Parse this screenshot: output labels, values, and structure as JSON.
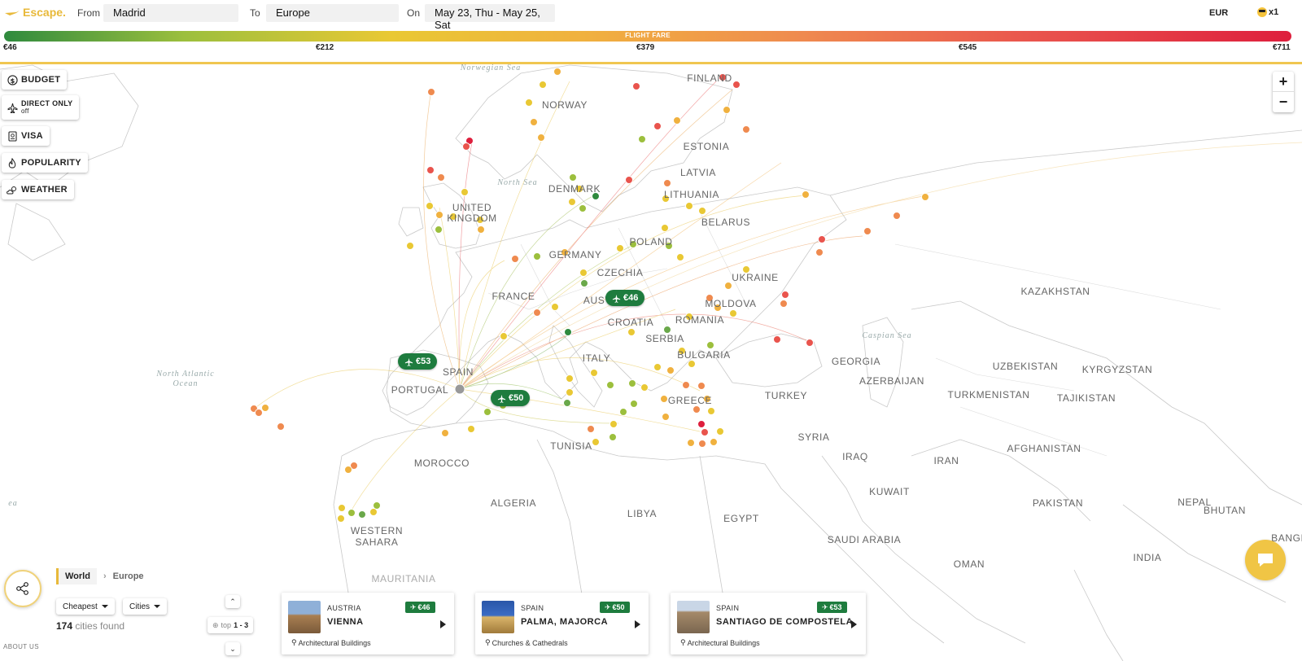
{
  "header": {
    "logo": "Escape.",
    "from_label": "From",
    "from_value": "Madrid",
    "to_label": "To",
    "to_value": "Europe",
    "on_label": "On",
    "on_value": "May 23, Thu - May 25, Sat",
    "currency": "EUR",
    "passengers": "x1"
  },
  "fare_bar": {
    "title": "FLIGHT FARE",
    "ticks": [
      "€46",
      "€212",
      "€379",
      "€545",
      "€711"
    ],
    "colors": [
      "#2f8a3e",
      "#e9c834",
      "#ef8a4f",
      "#de1f3d"
    ]
  },
  "filters": [
    {
      "label": "BUDGET",
      "icon": "dollar-icon"
    },
    {
      "label": "DIRECT ONLY",
      "sub": "off",
      "icon": "plane-icon"
    },
    {
      "label": "VISA",
      "icon": "passport-icon"
    },
    {
      "label": "POPULARITY",
      "icon": "flame-icon"
    },
    {
      "label": "WEATHER",
      "icon": "cloud-sun-icon"
    }
  ],
  "zoom": {
    "in": "+",
    "out": "−"
  },
  "map": {
    "countries": [
      {
        "name": "FINLAND"
      },
      {
        "name": "NORWAY"
      },
      {
        "name": "ESTONIA"
      },
      {
        "name": "LATVIA"
      },
      {
        "name": "DENMARK"
      },
      {
        "name": "LITHUANIA"
      },
      {
        "name": "UNITED\nKINGDOM"
      },
      {
        "name": "BELARUS"
      },
      {
        "name": "POLAND"
      },
      {
        "name": "GERMANY"
      },
      {
        "name": "CZECHIA"
      },
      {
        "name": "UKRAINE"
      },
      {
        "name": "FRANCE"
      },
      {
        "name": "AUSTRIA"
      },
      {
        "name": "MOLDOVA"
      },
      {
        "name": "ROMANIA"
      },
      {
        "name": "CROATIA"
      },
      {
        "name": "SERBIA"
      },
      {
        "name": "BULGARIA"
      },
      {
        "name": "ITALY"
      },
      {
        "name": "SPAIN"
      },
      {
        "name": "PORTUGAL"
      },
      {
        "name": "GREECE"
      },
      {
        "name": "TURKEY"
      },
      {
        "name": "GEORGIA"
      },
      {
        "name": "AZERBAIJAN"
      },
      {
        "name": "KAZAKHSTAN"
      },
      {
        "name": "UZBEKISTAN"
      },
      {
        "name": "KYRGYZSTAN"
      },
      {
        "name": "TURKMENISTAN"
      },
      {
        "name": "TAJIKISTAN"
      },
      {
        "name": "TUNISIA"
      },
      {
        "name": "SYRIA"
      },
      {
        "name": "MOROCCO"
      },
      {
        "name": "IRAQ"
      },
      {
        "name": "IRAN"
      },
      {
        "name": "AFGHANISTAN"
      },
      {
        "name": "ALGERIA"
      },
      {
        "name": "LIBYA"
      },
      {
        "name": "EGYPT"
      },
      {
        "name": "KUWAIT"
      },
      {
        "name": "PAKISTAN"
      },
      {
        "name": "NEPAL"
      },
      {
        "name": "BHUTAN"
      },
      {
        "name": "WESTERN\nSAHARA"
      },
      {
        "name": "SAUDI ARABIA"
      },
      {
        "name": "OMAN"
      },
      {
        "name": "INDIA"
      },
      {
        "name": "BANGL"
      },
      {
        "name": "MAURITANIA"
      }
    ],
    "seas": [
      {
        "name": "Norwegian Sea"
      },
      {
        "name": "North Sea"
      },
      {
        "name": "North Atlantic\nOcean"
      },
      {
        "name": "Caspian Sea"
      },
      {
        "name": "ea"
      }
    ],
    "price_pins": [
      {
        "label": "€46",
        "color": "#1e7c3e"
      },
      {
        "label": "€53",
        "color": "#3e8e3a"
      },
      {
        "label": "€50",
        "color": "#2f8a3e"
      }
    ]
  },
  "bottom": {
    "breadcrumb": [
      "World",
      "Europe"
    ],
    "sort_label": "Cheapest",
    "group_label": "Cities",
    "found_count": "174",
    "found_text": "cities found",
    "top_label": "top",
    "top_range": "1 - 3",
    "about": "ABOUT US"
  },
  "cards": [
    {
      "country": "AUSTRIA",
      "city": "VIENNA",
      "price": "€46",
      "tag": "Architectural Buildings"
    },
    {
      "country": "SPAIN",
      "city": "PALMA, MAJORCA",
      "price": "€50",
      "tag": "Churches & Cathedrals"
    },
    {
      "country": "SPAIN",
      "city": "SANTIAGO DE COMPOSTELA",
      "price": "€53",
      "tag": "Architectural Buildings"
    }
  ]
}
